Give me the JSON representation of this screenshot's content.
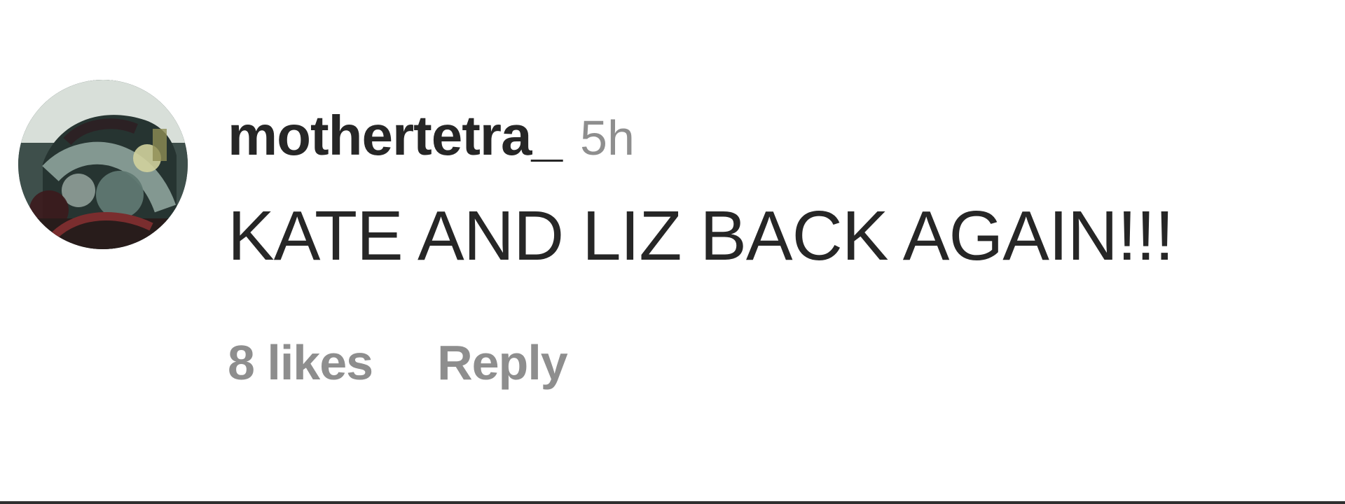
{
  "comment": {
    "username": "mothertetra_",
    "time_ago": "5h",
    "text": "KATE AND LIZ BACK AGAIN!!!",
    "likes_label": "8 likes",
    "reply_label": "Reply"
  },
  "colors": {
    "primary_text": "#262626",
    "secondary_text": "#8e8e8e",
    "background": "#ffffff"
  }
}
